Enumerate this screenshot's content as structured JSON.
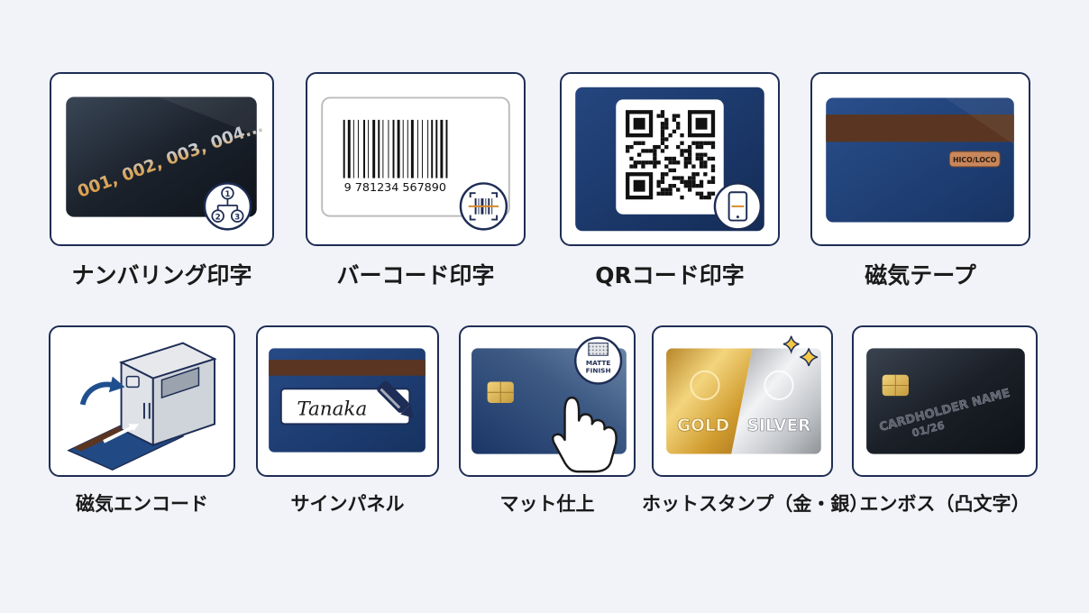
{
  "features": [
    {
      "id": "numbering",
      "label": "ナンバリング印字",
      "card_text": "001, 002, 003, 004...",
      "badge_digits": [
        "1",
        "2",
        "3"
      ]
    },
    {
      "id": "barcode",
      "label": "バーコード印字",
      "barcode_digits": "9  781234  567890"
    },
    {
      "id": "qrcode",
      "label": "QRコード印字"
    },
    {
      "id": "mag-stripe",
      "label": "磁気テープ",
      "chip_text": "HICO/LOCO"
    },
    {
      "id": "mag-encode",
      "label": "磁気エンコード"
    },
    {
      "id": "signature-panel",
      "label": "サインパネル",
      "signature": "Tanaka"
    },
    {
      "id": "matte",
      "label": "マット仕上",
      "badge_line1": "MATTE",
      "badge_line2": "FINISH"
    },
    {
      "id": "hot-stamp",
      "label": "ホットスタンプ（金・銀）",
      "gold_text": "GOLD",
      "silver_text": "SILVER"
    },
    {
      "id": "emboss",
      "label": "エンボス（凸文字）",
      "emboss_name": "CARDHOLDER NAME",
      "emboss_date": "01/26"
    }
  ],
  "colors": {
    "navy": "#1e2d55",
    "card_blue": "#1d3d73",
    "stripe_brown": "#5a3622",
    "gold": "#d8a431",
    "silver": "#c8c9cc",
    "background": "#f2f3f8"
  }
}
